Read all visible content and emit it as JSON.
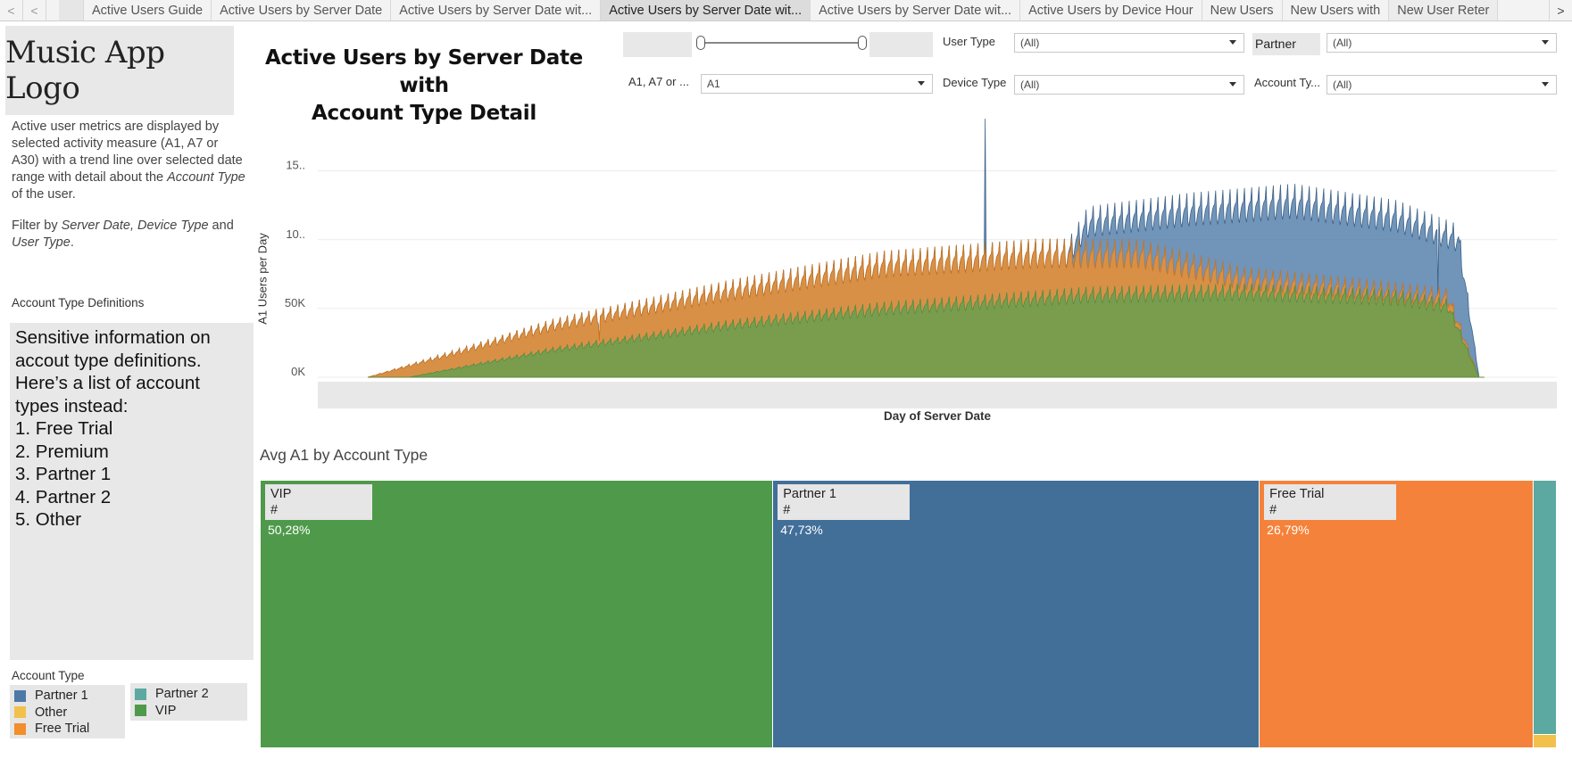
{
  "tabs": [
    {
      "label": "Active Users Guide",
      "active": false
    },
    {
      "label": "Active Users by Server Date",
      "active": false
    },
    {
      "label": "Active Users by Server Date wit...",
      "active": false
    },
    {
      "label": "Active Users by Server Date wit...",
      "active": true
    },
    {
      "label": "Active Users by Server Date wit...",
      "active": false
    },
    {
      "label": "Active Users by Device Hour",
      "active": false
    },
    {
      "label": "New Users",
      "active": false
    },
    {
      "label": "New Users with",
      "active": false
    },
    {
      "label": "New User Reter",
      "active": false
    }
  ],
  "nav": {
    "prev": "<",
    "next": ">"
  },
  "left_panel": {
    "logo_text": "Music App Logo",
    "description_parts": [
      {
        "text": "Active user metrics are displayed by selected activity measure (A1, A7 or A30) with a trend line over selected date range with detail about the ",
        "italic": false
      },
      {
        "text": "Account Type",
        "italic": true
      },
      {
        "text": " of the user.",
        "italic": false
      }
    ],
    "filter_note_parts": [
      {
        "text": "Filter by ",
        "italic": false
      },
      {
        "text": "Server Date, Device Type",
        "italic": true
      },
      {
        "text": " and ",
        "italic": false
      },
      {
        "text": "User Type",
        "italic": true
      },
      {
        "text": ".",
        "italic": false
      }
    ],
    "definitions_title": "Account Type Definitions",
    "definitions_intro": "Sensitive information on accout type definitions. Here’s a list of account types instead:",
    "definitions_list": [
      "1. Free Trial",
      "2. Premium",
      "3. Partner 1",
      "4. Partner 2",
      "5. Other"
    ]
  },
  "legend": {
    "title": "Account Type",
    "col1": [
      {
        "label": "Partner 1",
        "color": "#4e79a7"
      },
      {
        "label": "Other",
        "color": "#f1c14c"
      },
      {
        "label": "Free Trial",
        "color": "#f28e2b"
      }
    ],
    "col2": [
      {
        "label": "Partner 2",
        "color": "#5ba9a0"
      },
      {
        "label": "VIP",
        "color": "#4e9a4a"
      }
    ]
  },
  "title_line1": "Active Users by Server Date with",
  "title_line2": "Account Type Detail",
  "filters": {
    "user_type_label": "User Type",
    "user_type_value": "(All)",
    "partner_label": "Partner",
    "partner_value": "(All)",
    "measure_label": "A1, A7 or ...",
    "measure_value": "A1",
    "device_type_label": "Device Type",
    "device_type_value": "(All)",
    "account_type_label": "Account Ty...",
    "account_type_value": "(All)"
  },
  "chart_data": [
    {
      "type": "area",
      "stacked": true,
      "ylabel": "A1 Users per Day",
      "xlabel": "Day of Server Date",
      "y_tick_labels": [
        "0K",
        "50K",
        "10..",
        "15.."
      ],
      "y_ticks": [
        0,
        50000,
        100000,
        150000
      ],
      "ylim": [
        0,
        190000
      ],
      "x_days": 1100,
      "series": [
        {
          "name": "VIP",
          "color": "#59a14f",
          "points": [
            [
              40,
              0
            ],
            [
              180,
              20000
            ],
            [
              350,
              38000
            ],
            [
              500,
              50000
            ],
            [
              700,
              60000
            ],
            [
              850,
              62000
            ],
            [
              1000,
              58000
            ],
            [
              1050,
              52000
            ],
            [
              1080,
              0
            ]
          ]
        },
        {
          "name": "Free Trial",
          "color": "#f28e2b",
          "points": [
            [
              0,
              0
            ],
            [
              180,
              38000
            ],
            [
              350,
              63000
            ],
            [
              500,
              82000
            ],
            [
              650,
              90000
            ],
            [
              750,
              90000
            ],
            [
              850,
              72000
            ],
            [
              1000,
              62000
            ],
            [
              1050,
              58000
            ],
            [
              1080,
              0
            ]
          ]
        },
        {
          "name": "Partner 1",
          "color": "#4e79a7",
          "points": [
            [
              0,
              0
            ],
            [
              600,
              0
            ],
            [
              700,
              113000
            ],
            [
              800,
              122000
            ],
            [
              900,
              128000
            ],
            [
              1000,
              117000
            ],
            [
              1060,
              101000
            ],
            [
              1080,
              0
            ]
          ]
        }
      ],
      "spike_day": 600,
      "spike_value": 188000,
      "grid": true
    },
    {
      "type": "treemap",
      "title": "Avg A1 by Account Type",
      "categories": [
        "VIP",
        "Partner 1",
        "Free Trial",
        "Partner 2",
        "Other"
      ],
      "values": [
        35.2,
        33.4,
        18.8,
        1.5,
        0.1
      ],
      "percent_labels": [
        "50,28%",
        "47,73%",
        "26,79%",
        "",
        ""
      ],
      "value_labels": [
        "#",
        "#",
        "#",
        "",
        ""
      ],
      "colors": [
        "#4e9a4a",
        "#426f98",
        "#f5823a",
        "#5ba9a0",
        "#f1c14c"
      ]
    }
  ]
}
